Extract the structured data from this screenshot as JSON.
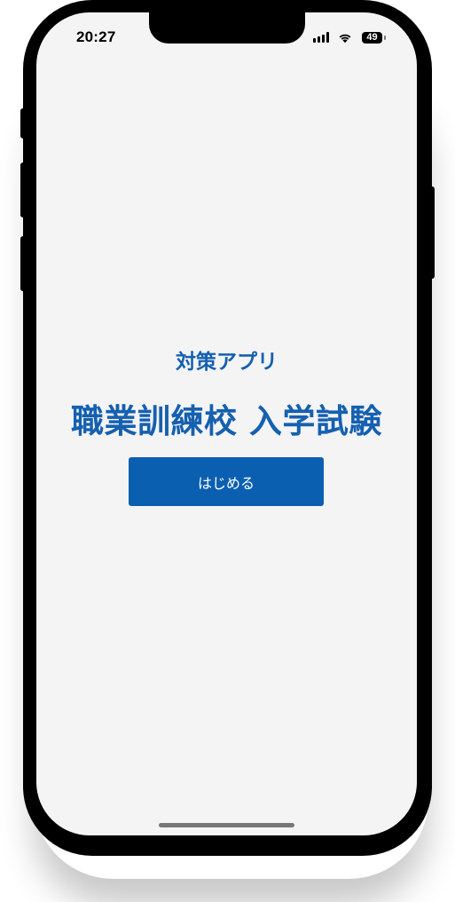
{
  "status_bar": {
    "time": "20:27",
    "battery_level": "49",
    "signal_icon": "cellular-signal-icon",
    "wifi_icon": "wifi-icon",
    "battery_icon": "battery-icon"
  },
  "main": {
    "subtitle": "対策アプリ",
    "title": "職業訓練校 入学試験",
    "start_button_label": "はじめる"
  },
  "colors": {
    "accent": "#1560b0",
    "button": "#0b5fb0",
    "screen_background": "#f4f4f5"
  }
}
